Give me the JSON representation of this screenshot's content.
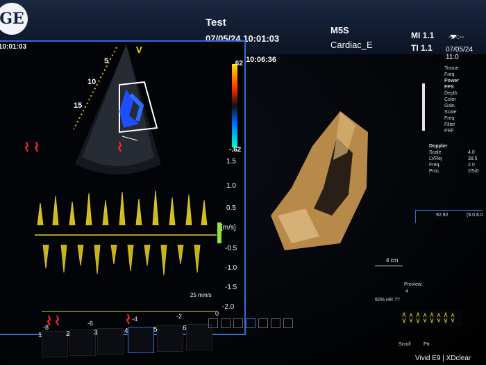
{
  "header": {
    "logo_text": "GE",
    "patient_name": "Test",
    "datetime": "07/05/24 10:01:03",
    "probe": "M5S",
    "preset": "Cardiac_E",
    "mi": "MI 1.1",
    "ti": "TI 1.1",
    "right_datetime": "07/05/24 11:0",
    "right_top": "-:--:--"
  },
  "left_panel": {
    "time": "10:01:03",
    "depth_labels": [
      "5",
      "10",
      "15"
    ],
    "v_marker": "V",
    "colorbar_top": ".62",
    "colorbar_bottom": "-.62",
    "unit": "[m/s]",
    "scale_labels": [
      "1.5",
      "1.0",
      "0.5",
      "-0.5",
      "-1.0",
      "-1.5",
      "-2.0"
    ],
    "speed": "25 mm/s",
    "time_axis": [
      "-8",
      "-6",
      "-4",
      "-2",
      "0"
    ]
  },
  "center": {
    "time": "10:06:36",
    "scale": "4 cm"
  },
  "right_panel": {
    "menu_items": [
      "Tissue",
      "Freq",
      "Power",
      "FPS",
      "Depth",
      "Color",
      "Gain",
      "Scale",
      "Freq",
      "Filter",
      "PRF"
    ],
    "doppler_labels": [
      "Doppler",
      "Scale",
      "LVRej",
      "Freq.",
      "Proc."
    ],
    "doppler_values": [
      "4.0",
      "38.5",
      "2.0",
      "2/5/0"
    ],
    "box_value": "92.92",
    "box_value2": "(8.0:8.0",
    "hr": "60% HR ??",
    "preview": "Preview:",
    "preview_val": "4",
    "bottom_tabs": [
      "Scroll",
      "Ptr"
    ],
    "brand": "Vivid E9 | XDclear"
  },
  "thumbnails": [
    "1",
    "2",
    "3",
    "4",
    "5",
    "6"
  ]
}
